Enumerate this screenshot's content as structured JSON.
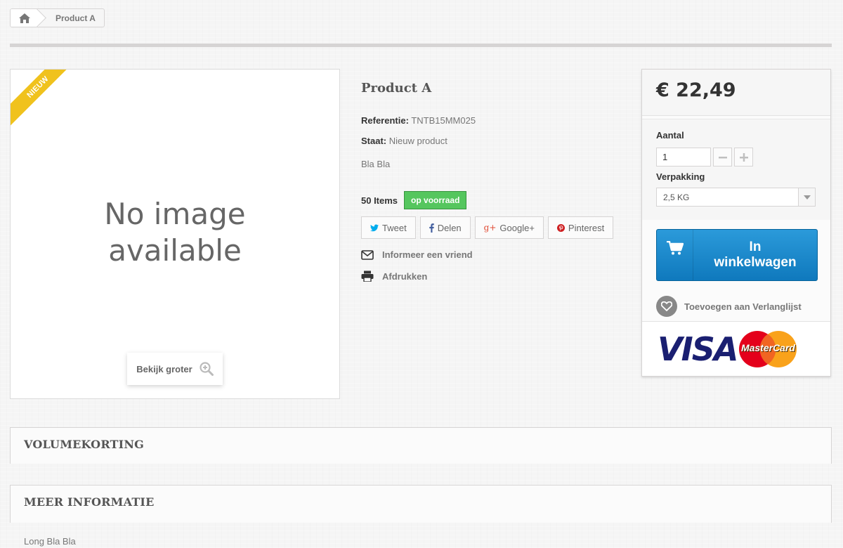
{
  "breadcrumb": {
    "home_icon": "home-icon",
    "current": "Product A"
  },
  "image": {
    "ribbon": "NIEUW",
    "placeholder": "No image\navailable",
    "view_larger": "Bekijk groter"
  },
  "product": {
    "title": "Product A",
    "reference_label": "Referentie:",
    "reference_value": "TNTB15MM025",
    "condition_label": "Staat:",
    "condition_value": "Nieuw product",
    "short_description": "Bla Bla",
    "stock_count": "50 Items",
    "stock_status": "op voorraad"
  },
  "share": [
    {
      "icon": "twitter-icon",
      "label": "Tweet",
      "color": "#00aced"
    },
    {
      "icon": "facebook-icon",
      "label": "Delen",
      "color": "#435f9f"
    },
    {
      "icon": "google-plus-icon",
      "label": "Google+",
      "color": "#e04b34"
    },
    {
      "icon": "pinterest-icon",
      "label": "Pinterest",
      "color": "#ce1f21"
    }
  ],
  "actions": {
    "inform_friend": "Informeer een vriend",
    "print": "Afdrukken"
  },
  "buy_box": {
    "price": "€ 22,49",
    "quantity_label": "Aantal",
    "quantity_value": "1",
    "packaging_label": "Verpakking",
    "packaging_value": "2,5 KG",
    "add_to_cart": "In\nwinkelwagen",
    "wishlist": "Toevoegen aan Verlanglijst",
    "payment_visa": "VISA",
    "payment_mastercard": "MasterCard"
  },
  "sections": {
    "volume_discount": "VOLUMEKORTING",
    "more_info": "MEER INFORMATIE",
    "more_info_text": "Long Bla Bla"
  },
  "colors": {
    "accent_blue": "#0f79bd",
    "stock_green": "#55c65e",
    "ribbon_yellow": "#f0c21d"
  }
}
